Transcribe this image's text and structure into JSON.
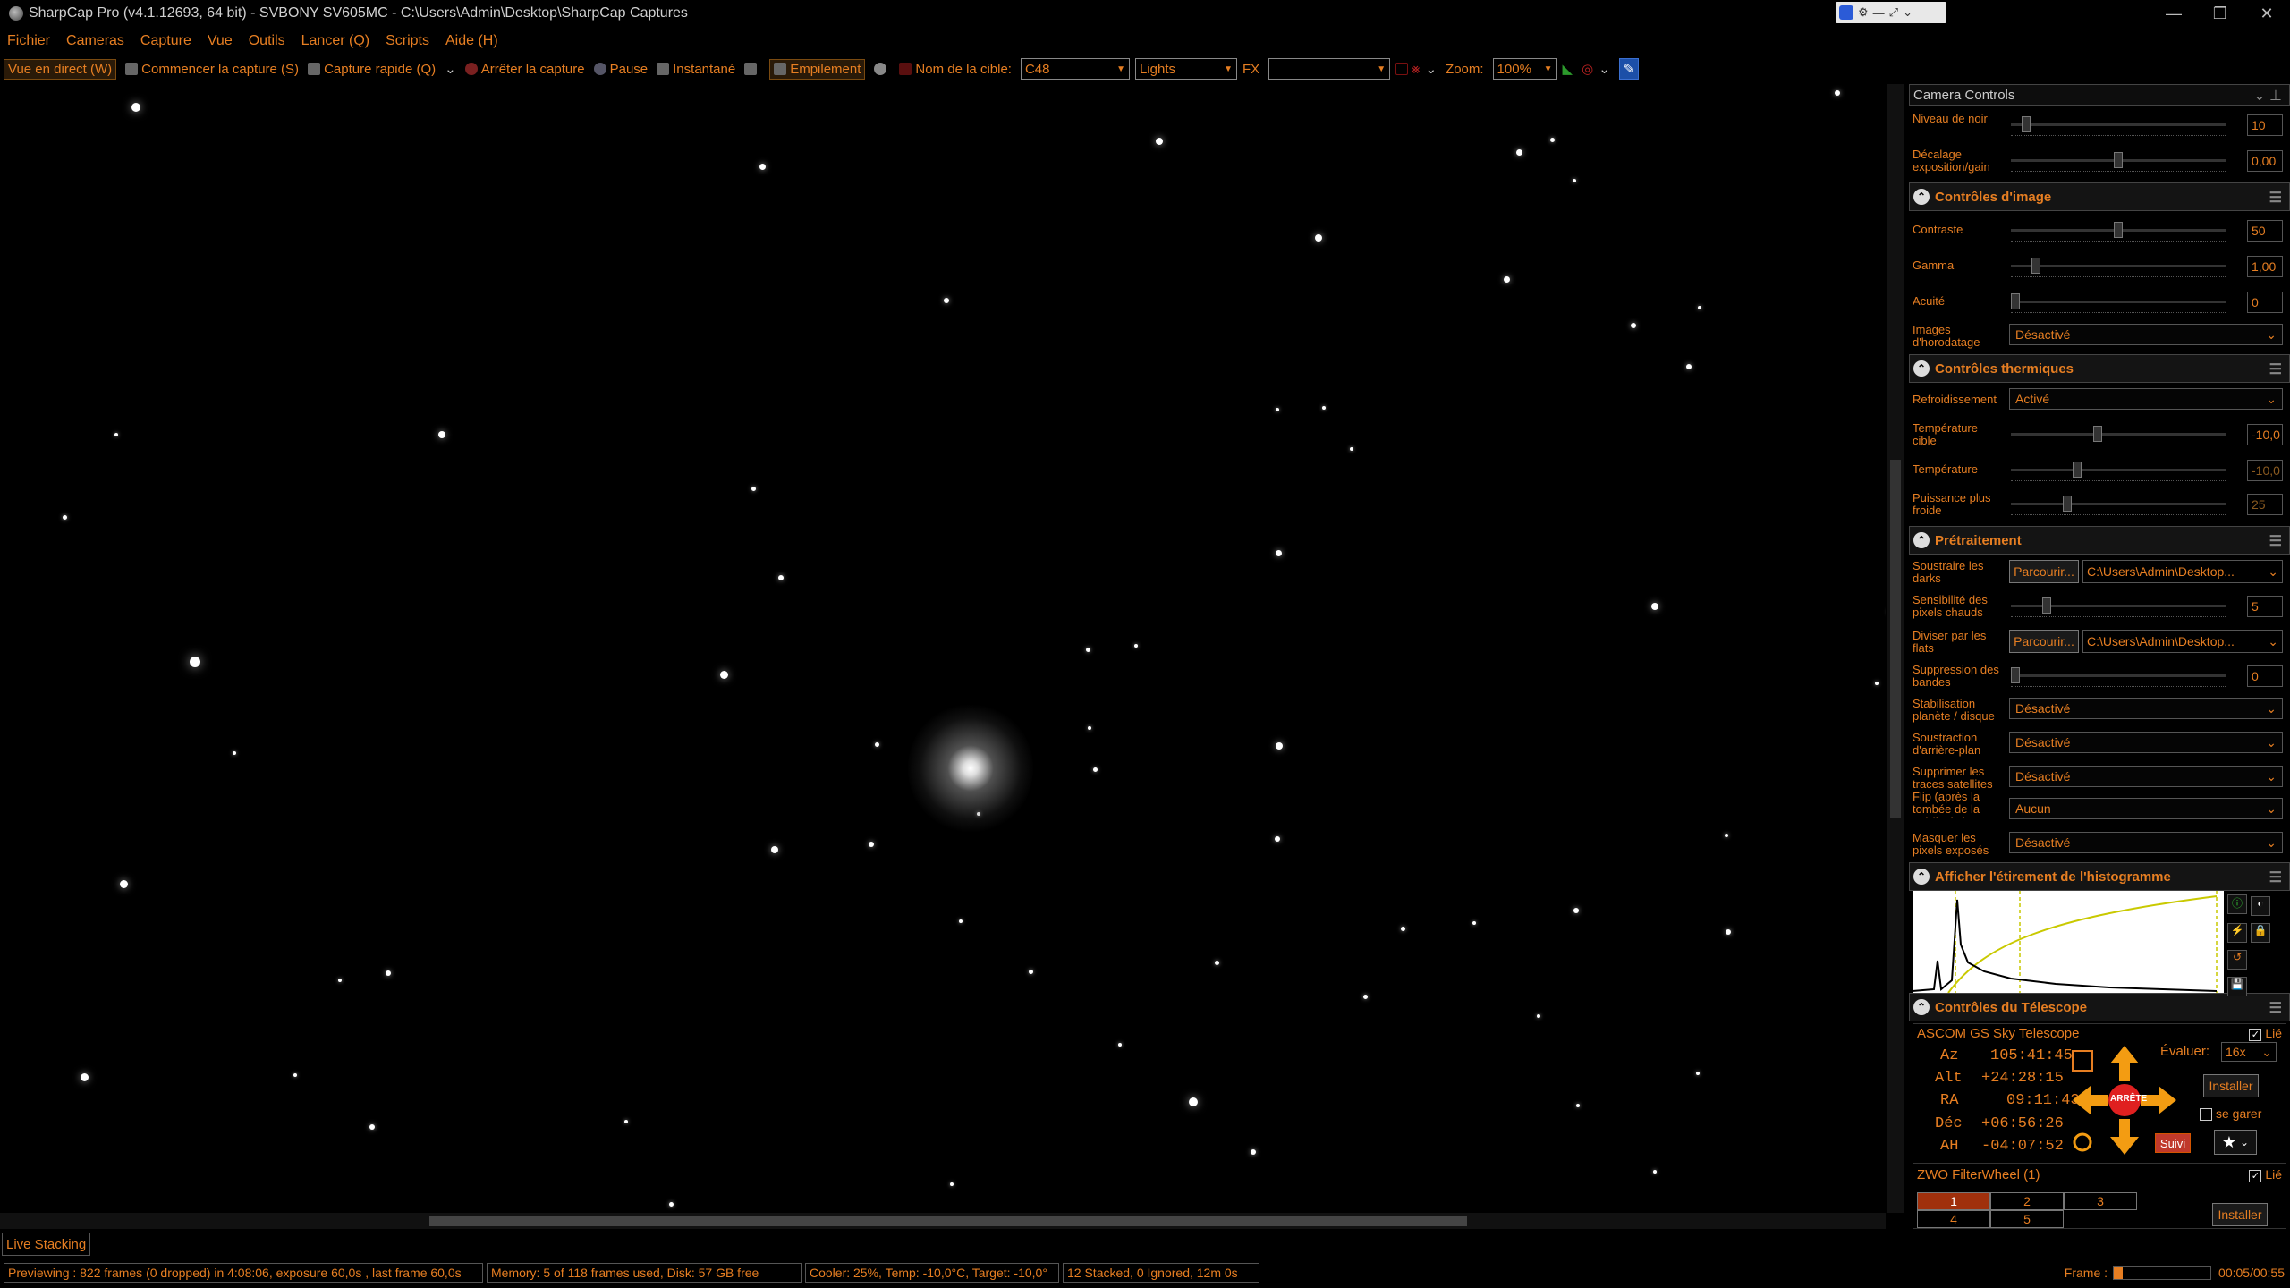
{
  "window": {
    "title": "SharpCap Pro (v4.1.12693, 64 bit) - SVBONY SV605MC - C:\\Users\\Admin\\Desktop\\SharpCap Captures"
  },
  "menu": [
    "Fichier",
    "Cameras",
    "Capture",
    "Vue",
    "Outils",
    "Lancer (Q)",
    "Scripts",
    "Aide (H)"
  ],
  "toolbar": {
    "live_view": "Vue en direct (W)",
    "start_capture": "Commencer la capture (S)",
    "quick_capture": "Capture rapide (Q)",
    "stop_capture": "Arrêter la capture",
    "pause": "Pause",
    "snapshot": "Instantané",
    "stacking": "Empilement",
    "target_label": "Nom de la cible:",
    "target_value": "C48",
    "frame_type": "Lights",
    "fx_label": "FX",
    "zoom_label": "Zoom:",
    "zoom_value": "100%"
  },
  "panel": {
    "camera_controls": {
      "title": "Camera Controls",
      "black_level": {
        "label": "Niveau de noir",
        "value": "10",
        "level": 0.05
      },
      "exposure_offset": {
        "label": "Décalage exposition/gain",
        "value": "0,00",
        "level": 0.5
      }
    },
    "image_controls": {
      "title": "Contrôles d'image",
      "contrast": {
        "label": "Contraste",
        "value": "50",
        "level": 0.5
      },
      "gamma": {
        "label": "Gamma",
        "value": "1,00",
        "level": 0.1
      },
      "sharpness": {
        "label": "Acuité",
        "value": "0",
        "level": 0
      },
      "timestamp": {
        "label": "Images d'horodatage",
        "value": "Désactivé"
      }
    },
    "thermal": {
      "title": "Contrôles thermiques",
      "cooling": {
        "label": "Refroidissement",
        "value": "Activé"
      },
      "target_temp": {
        "label": "Température cible",
        "value": "-10,0",
        "level": 0.4
      },
      "temperature": {
        "label": "Température",
        "value": "-10,0",
        "level": 0.3
      },
      "cooler_power": {
        "label": "Puissance plus froide",
        "value": "25",
        "level": 0.25
      }
    },
    "preprocessing": {
      "title": "Prétraitement",
      "darks": {
        "label": "Soustraire les darks",
        "button": "Parcourir...",
        "path": "C:\\Users\\Admin\\Desktop..."
      },
      "hot_pixels": {
        "label": "Sensibilité des pixels chauds",
        "value": "5",
        "level": 0.15
      },
      "flats": {
        "label": "Diviser par les flats",
        "button": "Parcourir...",
        "path": "C:\\Users\\Admin\\Desktop..."
      },
      "banding": {
        "label": "Suppression des bandes",
        "value": "0",
        "level": 0
      },
      "stabilization": {
        "label": "Stabilisation planète / disque",
        "value": "Désactivé"
      },
      "background": {
        "label": "Soustraction d'arrière-plan",
        "value": "Désactivé"
      },
      "satellite": {
        "label": "Supprimer les traces satellites",
        "value": "Désactivé"
      },
      "flip": {
        "label": "Flip (après la tombée de la nuit/à plat)",
        "value": "Aucun"
      },
      "mask": {
        "label": "Masquer les pixels exposés",
        "value": "Désactivé"
      }
    },
    "histogram": {
      "title": "Afficher l'étirement de l'histogramme"
    },
    "telescope": {
      "title": "Contrôles du Télescope",
      "driver": "ASCOM GS Sky Telescope",
      "linked": "Lié",
      "az_label": "Az",
      "az": "105:41:45",
      "alt_label": "Alt",
      "alt": "+24:28:15",
      "ra_label": "RA",
      "ra": "09:11:43",
      "dec_label": "Déc",
      "dec": "+06:56:26",
      "ha_label": "AH",
      "ha": "-04:07:52",
      "rate_label": "Évaluer:",
      "rate": "16x",
      "setup": "Installer",
      "park": "se garer",
      "stop": "ARRÊTE",
      "track": "Suivi"
    },
    "filterwheel": {
      "title": "ZWO FilterWheel (1)",
      "linked": "Lié",
      "slots": [
        "1",
        "2",
        "3",
        "4",
        "5"
      ],
      "setup": "Installer"
    }
  },
  "live_stacking": "Live Stacking",
  "status": {
    "preview": "Previewing : 822 frames (0 dropped) in 4:08:06, exposure 60,0s , last frame 60,0s",
    "memory": "Memory: 5 of 118 frames used, Disk: 57 GB free",
    "cooler": "Cooler: 25%, Temp: -10,0°C, Target: -10,0°",
    "stacked": "12 Stacked, 0 Ignored, 12m 0s",
    "frame_label": "Frame :",
    "frame_time": "00:05/00:55"
  }
}
